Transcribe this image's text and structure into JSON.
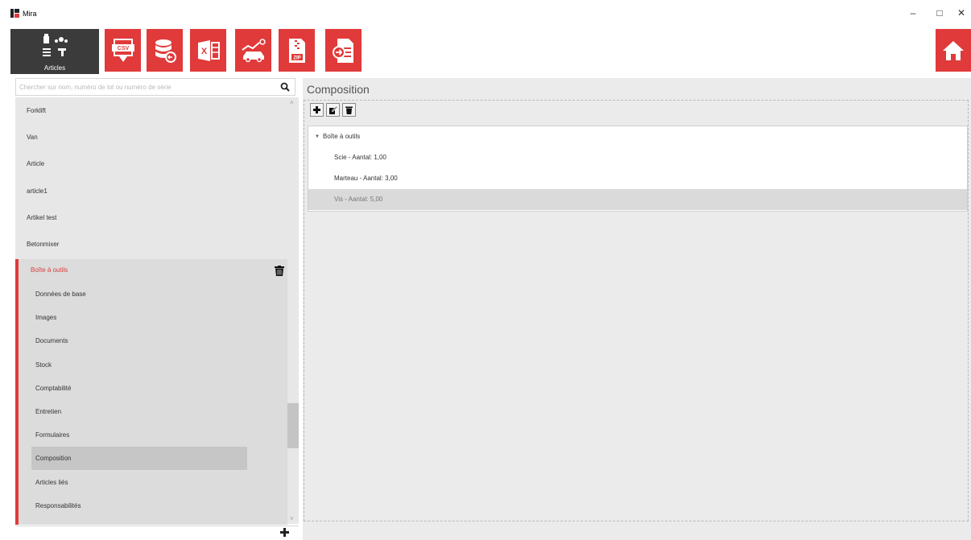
{
  "window": {
    "title": "Mira",
    "minimize": "–",
    "maximize": "□",
    "close": "✕"
  },
  "toolbar": {
    "articles_label": "Articles",
    "buttons": [
      "csv-export-icon",
      "database-icon",
      "excel-icon",
      "car-chart-icon",
      "zip-icon",
      "pdf-import-icon",
      "home-icon"
    ],
    "accent_color": "#e03a3a",
    "active_color": "#3b3b3b"
  },
  "search": {
    "placeholder": "Chercher sur nom, numéro de lot ou numéro de série",
    "value": ""
  },
  "articles": [
    "Forklift",
    "Van",
    "Article",
    "article1",
    "Artikel test",
    "Betonmixer"
  ],
  "selected_article": {
    "name": "Boîte à outils",
    "menu": [
      "Données de base",
      "Images",
      "Documents",
      "Stock",
      "Comptabilité",
      "Entretien",
      "Formulaires",
      "Composition",
      "Articles liés",
      "Responsabilités"
    ],
    "selected_menu": "Composition"
  },
  "composition": {
    "title": "Composition",
    "root": "Boîte à outils",
    "children": [
      "Scie - Aantal: 1,00",
      "Marteau - Aantal: 3,00",
      "Vis - Aantal: 5,00"
    ],
    "selected_child": "Vis - Aantal: 5,00"
  }
}
